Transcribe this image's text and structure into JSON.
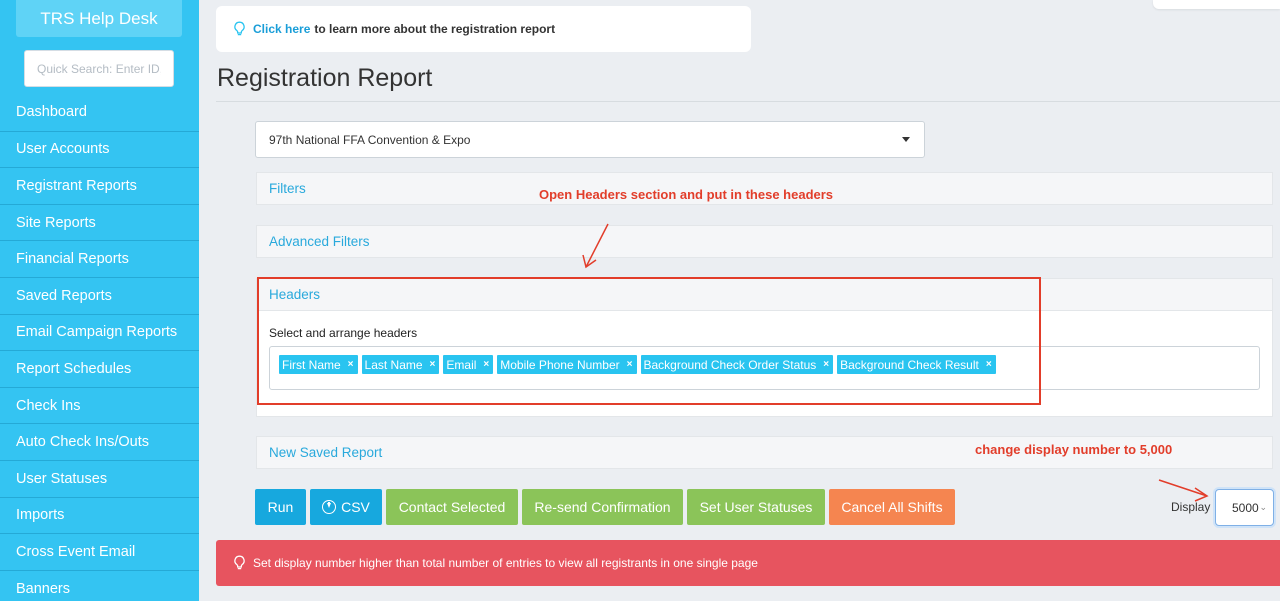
{
  "sidebar": {
    "brand": "TRS Help Desk",
    "search_placeholder": "Quick Search: Enter ID, I",
    "items": [
      {
        "label": "Dashboard"
      },
      {
        "label": "User Accounts"
      },
      {
        "label": "Registrant Reports"
      },
      {
        "label": "Site Reports"
      },
      {
        "label": "Financial Reports"
      },
      {
        "label": "Saved Reports"
      },
      {
        "label": "Email Campaign Reports"
      },
      {
        "label": "Report Schedules"
      },
      {
        "label": "Check Ins"
      },
      {
        "label": "Auto Check Ins/Outs"
      },
      {
        "label": "User Statuses"
      },
      {
        "label": "Imports"
      },
      {
        "label": "Cross Event Email"
      },
      {
        "label": "Banners"
      }
    ]
  },
  "info": {
    "icon": "lightbulb-icon",
    "link_text": "Click here",
    "rest_text": "to learn more about the registration report"
  },
  "page": {
    "title": "Registration Report",
    "event_selected": "97th National FFA Convention & Expo"
  },
  "panels": {
    "filters": "Filters",
    "advanced": "Advanced Filters",
    "headers": "Headers",
    "headers_label": "Select and arrange headers",
    "tags": [
      {
        "label": "First Name"
      },
      {
        "label": "Last Name"
      },
      {
        "label": "Email"
      },
      {
        "label": "Mobile Phone Number"
      },
      {
        "label": "Background Check Order Status"
      },
      {
        "label": "Background Check Result"
      }
    ],
    "tag_remove": "×",
    "new_saved": "New Saved Report"
  },
  "annotations": {
    "headers_note": "Open Headers section and put in these headers",
    "display_note": "change display number to 5,000",
    "color": "#e23d2a"
  },
  "actions": {
    "run": "Run",
    "csv": "CSV",
    "contact": "Contact Selected",
    "resend": "Re-send Confirmation",
    "statuses": "Set User Statuses",
    "cancel": "Cancel All Shifts",
    "display_label": "Display",
    "display_value": "5000"
  },
  "alert": {
    "icon": "lightbulb-icon",
    "text": "Set display number higher than total number of entries to view all registrants in one single page"
  },
  "colors": {
    "sidebar": "#34c4f2",
    "primary": "#17a8de",
    "success": "#8bc459",
    "warning": "#f58550",
    "danger": "#e7545f"
  }
}
